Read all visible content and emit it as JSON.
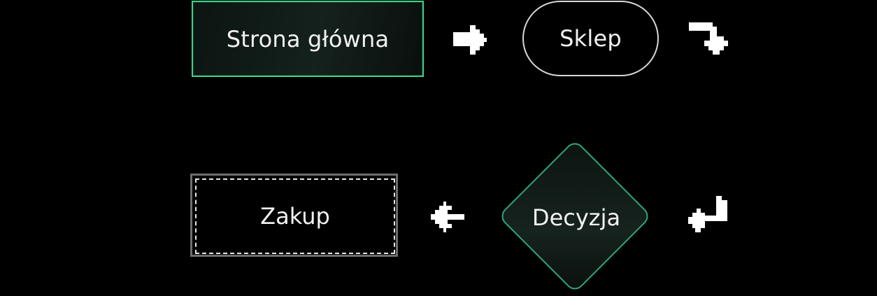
{
  "diagram": {
    "nodes": {
      "home": {
        "label": "Strona główna",
        "shape": "rectangle"
      },
      "shop": {
        "label": "Sklep",
        "shape": "rounded-pill"
      },
      "decision": {
        "label": "Decyzja",
        "shape": "diamond"
      },
      "purchase": {
        "label": "Zakup",
        "shape": "dashed-rectangle"
      }
    },
    "edges": [
      {
        "from": "home",
        "to": "shop",
        "icon": "arrow-right-icon"
      },
      {
        "from": "shop",
        "to": "decision",
        "icon": "arrow-turn-down-icon"
      },
      {
        "from": "decision",
        "to": "purchase",
        "icon": "arrow-left-icon"
      }
    ],
    "colors": {
      "accent_green": "#3ed18a",
      "background": "#000000",
      "text": "#f2f2f2",
      "dashed_border": "#e6e6e6"
    }
  }
}
